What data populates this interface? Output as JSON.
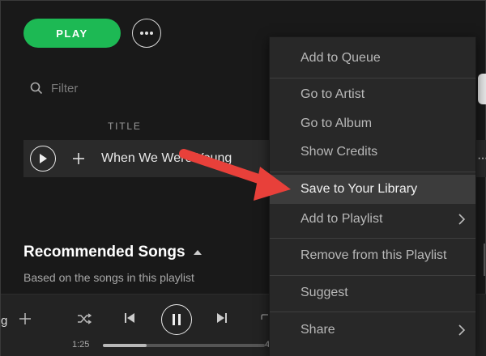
{
  "header": {
    "play_label": "PLAY"
  },
  "filter": {
    "placeholder": "Filter"
  },
  "table": {
    "title_header": "TITLE",
    "rows": [
      {
        "title": "When We Were Young"
      }
    ]
  },
  "recommended": {
    "title": "Recommended Songs",
    "subtitle": "Based on the songs in this playlist"
  },
  "player": {
    "track_tail": "g",
    "elapsed": "1:25",
    "remaining_tail": "4",
    "progress_fraction": 0.27
  },
  "context_menu": {
    "items": [
      {
        "label": "Add to Queue"
      },
      {
        "label": "Go to Artist"
      },
      {
        "label": "Go to Album"
      },
      {
        "label": "Show Credits"
      },
      {
        "label": "Save to Your Library",
        "highlighted": true
      },
      {
        "label": "Add to Playlist",
        "submenu": true
      },
      {
        "label": "Remove from this Playlist"
      },
      {
        "label": "Suggest"
      },
      {
        "label": "Share",
        "submenu": true
      }
    ]
  },
  "colors": {
    "accent": "#1db954",
    "arrow": "#e8403a"
  }
}
